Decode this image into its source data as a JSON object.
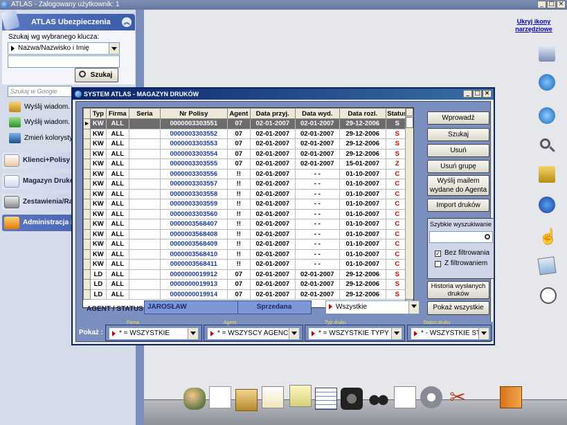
{
  "window": {
    "title": "ATLAS  -  Zalogowany użytkownik: 1"
  },
  "sidebar": {
    "title": "ATLAS Ubezpieczenia",
    "search_label": "Szukaj wg wybranego klucza:",
    "key_select": "Nazwa/Nazwisko i Imię",
    "search_button": "Szukaj",
    "google_placeholder": "Szukaj w Google",
    "links": [
      "Wyślij wiadom.",
      "Wyślij wiadom.",
      "Zmień kolorysty"
    ],
    "nav": [
      "Klienci+Polisy",
      "Magazyn Druków",
      "Zestawienia/Ra",
      "Administracja i"
    ]
  },
  "right_panel": {
    "hide_icons": "Ukryj ikony narzędziowe"
  },
  "dialog": {
    "title": "SYSTEM ATLAS  - MAGAZYN DRUKÓW",
    "columns": [
      "Typ",
      "Firma",
      "Seria",
      "Nr Polisy",
      "Agent",
      "Data przyj.",
      "Data wyd.",
      "Data rozl.",
      "Status"
    ],
    "rows": [
      [
        "KW",
        "ALL",
        "",
        "0000003303551",
        "07",
        "02-01-2007",
        "02-01-2007",
        "29-12-2006",
        "S"
      ],
      [
        "KW",
        "ALL",
        "",
        "0000003303552",
        "07",
        "02-01-2007",
        "02-01-2007",
        "29-12-2006",
        "S"
      ],
      [
        "KW",
        "ALL",
        "",
        "0000003303553",
        "07",
        "02-01-2007",
        "02-01-2007",
        "29-12-2006",
        "S"
      ],
      [
        "KW",
        "ALL",
        "",
        "0000003303554",
        "07",
        "02-01-2007",
        "02-01-2007",
        "29-12-2006",
        "S"
      ],
      [
        "KW",
        "ALL",
        "",
        "0000003303555",
        "07",
        "02-01-2007",
        "02-01-2007",
        "15-01-2007",
        "Z"
      ],
      [
        "KW",
        "ALL",
        "",
        "0000003303556",
        "!!",
        "02-01-2007",
        "- -",
        "01-10-2007",
        "C"
      ],
      [
        "KW",
        "ALL",
        "",
        "0000003303557",
        "!!",
        "02-01-2007",
        "- -",
        "01-10-2007",
        "C"
      ],
      [
        "KW",
        "ALL",
        "",
        "0000003303558",
        "!!",
        "02-01-2007",
        "- -",
        "01-10-2007",
        "C"
      ],
      [
        "KW",
        "ALL",
        "",
        "0000003303559",
        "!!",
        "02-01-2007",
        "- -",
        "01-10-2007",
        "C"
      ],
      [
        "KW",
        "ALL",
        "",
        "0000003303560",
        "!!",
        "02-01-2007",
        "- -",
        "01-10-2007",
        "C"
      ],
      [
        "KW",
        "ALL",
        "",
        "0000003568407",
        "!!",
        "02-01-2007",
        "- -",
        "01-10-2007",
        "C"
      ],
      [
        "KW",
        "ALL",
        "",
        "0000003568408",
        "!!",
        "02-01-2007",
        "- -",
        "01-10-2007",
        "C"
      ],
      [
        "KW",
        "ALL",
        "",
        "0000003568409",
        "!!",
        "02-01-2007",
        "- -",
        "01-10-2007",
        "C"
      ],
      [
        "KW",
        "ALL",
        "",
        "0000003568410",
        "!!",
        "02-01-2007",
        "- -",
        "01-10-2007",
        "C"
      ],
      [
        "KW",
        "ALL",
        "",
        "0000003568411",
        "!!",
        "02-01-2007",
        "- -",
        "01-10-2007",
        "C"
      ],
      [
        "LD",
        "ALL",
        "",
        "0000000019912",
        "07",
        "02-01-2007",
        "02-01-2007",
        "29-12-2006",
        "S"
      ],
      [
        "LD",
        "ALL",
        "",
        "0000000019913",
        "07",
        "02-01-2007",
        "02-01-2007",
        "29-12-2006",
        "S"
      ],
      [
        "LD",
        "ALL",
        "",
        "0000000019914",
        "07",
        "02-01-2007",
        "02-01-2007",
        "29-12-2006",
        "S"
      ]
    ],
    "agent_status_label": "AGENT / STATUS",
    "agent_name": "JAROSŁAW",
    "status_value": "Sprzedana",
    "status_filter": "Wszystkie",
    "buttons": {
      "wprowadz": "Wprowadź",
      "szukaj": "Szukaj",
      "usun": "Usuń",
      "usun_grupe": "Usuń grupę",
      "wyslij_line1": "Wyślij mailem",
      "wyslij_line2": "wydane do Agenta",
      "import": "Import druków",
      "historia_line1": "Historia wysłanych",
      "historia_line2": "druków",
      "pokaz_wszystkie": "Pokaż wszystkie"
    },
    "fast_search": {
      "label": "Szybkie wyszukiwanie",
      "bez_filtrowania": "Bez filtrowania",
      "z_filtrowaniem": "Z filtrowaniem"
    },
    "filters": {
      "pokaz_label": "Pokaż :",
      "firma_caption": "Firma",
      "firma_value": "* = WSZYSTKIE",
      "agent_caption": "Agent",
      "agent_value": "* = WSZYSCY AGENCI",
      "typ_caption": "Typ druku",
      "typ_value": "* = WSZYSTKIE TYPY",
      "status_caption": "Status druku",
      "status_value": "* - WSZYSTKIE STAT"
    }
  }
}
